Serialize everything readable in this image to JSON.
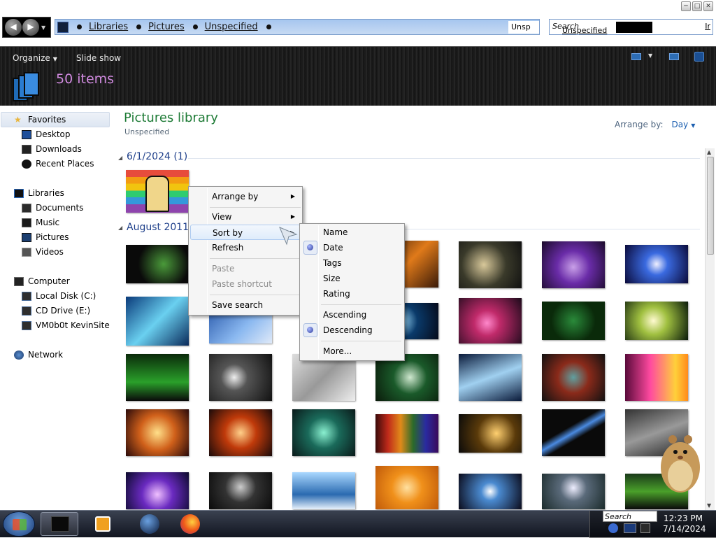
{
  "window": {
    "minimize": "─",
    "maximize": "□",
    "close": "✕"
  },
  "nav": {
    "back_icon": "back-arrow-icon",
    "forward_icon": "forward-arrow-icon",
    "drop": "▼"
  },
  "address_bar": {
    "crumbs": [
      "Libraries",
      "Pictures",
      "Unspecified"
    ],
    "right_text": "Unsp"
  },
  "search_box": {
    "label": "Search",
    "value": "Unspecified",
    "right_text": "Ir"
  },
  "toolbar": {
    "organize": "Organize",
    "organize_drop": "▼",
    "slide_show": "Slide show",
    "item_count": "50 items"
  },
  "sidebar": {
    "favorites": {
      "label": "Favorites",
      "items": [
        "Desktop",
        "Downloads",
        "Recent Places"
      ]
    },
    "libraries": {
      "label": "Libraries",
      "items": [
        "Documents",
        "Music",
        "Pictures",
        "Videos"
      ]
    },
    "computer": {
      "label": "Computer",
      "items": [
        "Local Disk (C:)",
        "CD Drive (E:)",
        "VM0b0t KevinSite"
      ]
    },
    "network": {
      "label": "Network"
    }
  },
  "content": {
    "title": "Pictures library",
    "subtitle": "Unspecified",
    "arrange_label": "Arrange by:",
    "arrange_value": "Day",
    "arrange_drop": "▼",
    "groups": [
      {
        "label": "6/1/2024 (1)",
        "toggle": "◢"
      },
      {
        "label": "August 2011",
        "toggle": "◢"
      }
    ]
  },
  "context_menu": {
    "items": [
      {
        "label": "Arrange by",
        "submenu": true
      },
      {
        "label": "View",
        "submenu": true
      },
      {
        "label": "Sort by",
        "submenu": true,
        "highlighted": true
      },
      {
        "label": "Refresh"
      },
      {
        "label": "Paste",
        "disabled": true
      },
      {
        "label": "Paste shortcut",
        "disabled": true
      },
      {
        "label": "Save search"
      }
    ],
    "submenu_arrow": "▶"
  },
  "sort_submenu": {
    "items": [
      {
        "label": "Name"
      },
      {
        "label": "Date",
        "checked": true
      },
      {
        "label": "Tags"
      },
      {
        "label": "Size"
      },
      {
        "label": "Rating"
      },
      {
        "label": "Ascending"
      },
      {
        "label": "Descending",
        "checked": true
      },
      {
        "label": "More..."
      }
    ]
  },
  "taskbar": {
    "apps": [
      "explorer",
      "media-player",
      "globe",
      "firefox"
    ],
    "clock_time": "12:23 PM",
    "clock_date": "7/14/2024",
    "tray_search": "Search Picture"
  },
  "scrollbar": {
    "up": "▲",
    "down": "▼"
  },
  "colors": {
    "library_title": "#1e7b36",
    "item_count": "#d08adf",
    "group_header": "#1e3f8a",
    "toolbar_bg": "#1a1a1a"
  }
}
